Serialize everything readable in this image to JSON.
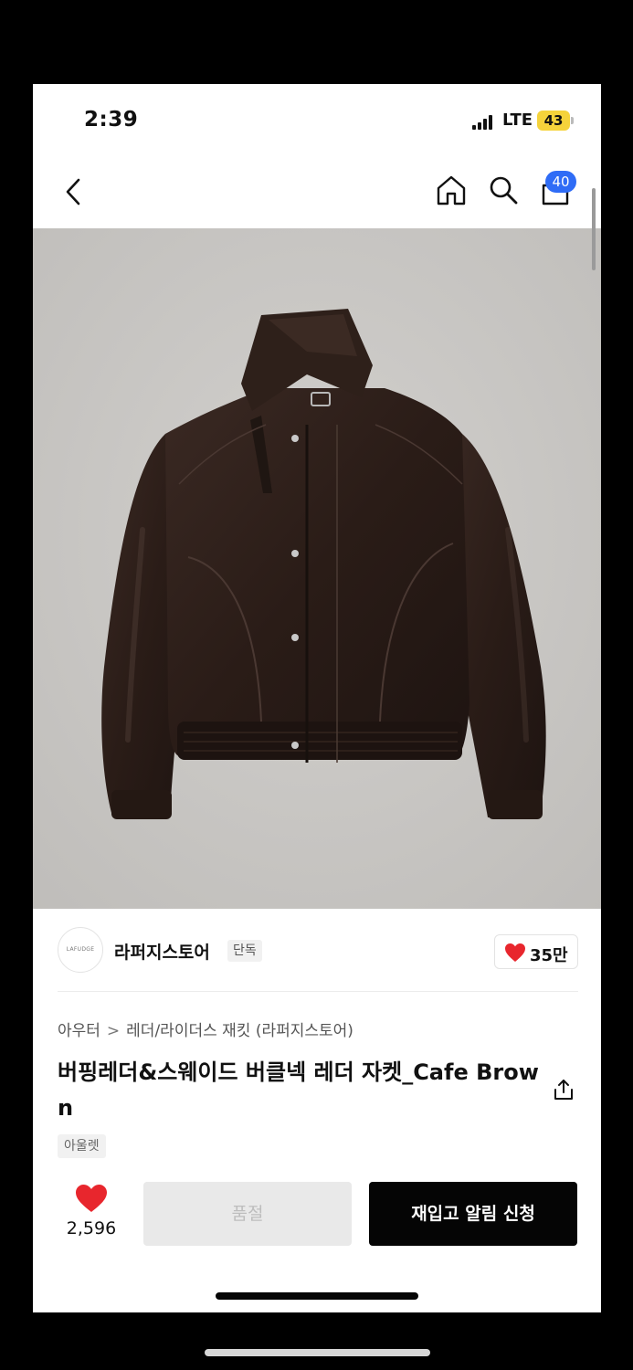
{
  "status_bar": {
    "time": "2:39",
    "network": "LTE",
    "battery": "43"
  },
  "nav": {
    "cart_count": "40"
  },
  "store": {
    "logo_text": "LAFUDGE",
    "name": "라퍼지스토어",
    "tag": "단독",
    "likes": "35만"
  },
  "breadcrumb": {
    "category": "아우터",
    "separator": ">",
    "subcategory": "레더/라이더스 재킷 (라퍼지스토어)"
  },
  "product": {
    "title": "버핑레더&스웨이드 버클넥 레더 자켓_Cafe Brown",
    "chip": "아울렛"
  },
  "actions": {
    "wish_count": "2,596",
    "soldout_label": "품절",
    "restock_label": "재입고 알림 신청"
  },
  "colors": {
    "accent_blue": "#2f6cf6",
    "heart_red": "#e8262d",
    "button_dark": "#050505",
    "image_bg": "#c9c7c4",
    "jacket": "#2b1d18"
  },
  "icons": [
    "back-icon",
    "home-icon",
    "search-icon",
    "cart-icon",
    "heart-icon",
    "share-icon"
  ]
}
